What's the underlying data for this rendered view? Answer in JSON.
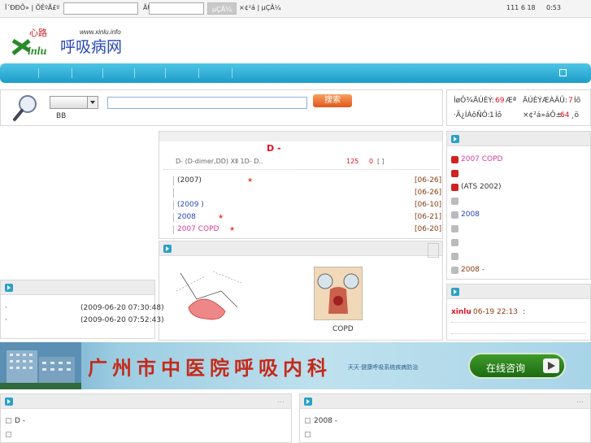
{
  "topbar": {
    "user_label": "Ï´ÐÐÕ» | ÕÊºÅ£º",
    "pass_label": "ÃÜÂë£º",
    "login_button": "µÇÂ¼",
    "register_links": "×¢²á | µÇÂ¼",
    "date": "111 6 18",
    "time": "0:53"
  },
  "logo": {
    "mark": "Xinlu",
    "url": "www.xinlu.info",
    "title": "呼吸病网",
    "top_glyph": "心路"
  },
  "search": {
    "select_value": "",
    "below_label": "BB",
    "button_label": "搜索"
  },
  "stats": {
    "line1_a": "ÍøÕ¾ÄÚÈÝ:",
    "line1_a_val": "69",
    "line1_a_unit": "Æª",
    "line1_b": "ÄÚÈÝÆÀÂÛ:",
    "line1_b_val": "7",
    "line1_b_unit": "Ìõ",
    "line2_a": "·Ã¿ÍÁôÑÔ:",
    "line2_a_val": "1",
    "line2_a_unit": "Ìõ",
    "line2_b": "×¢²á»áÔ±:",
    "line2_b_val": "64",
    "line2_b_unit": "¸ö"
  },
  "headline": {
    "title": "D -",
    "subtitle": "D-   (D-dimer,DD)       XⅡ                     1D-      D..",
    "hits": "125",
    "comments": "0",
    "more": "[ ]"
  },
  "news_list": [
    {
      "text": "(2007)",
      "date": "[06-26]",
      "star": true,
      "color": "dark"
    },
    {
      "text": "",
      "date": "[06-26]",
      "star": false,
      "color": "dark"
    },
    {
      "text": "(2009 )",
      "date": "[06-10]",
      "star": false,
      "color": "blue"
    },
    {
      "text": "2008",
      "date": "[06-21]",
      "star": true,
      "color": "blue"
    },
    {
      "text": "2007   COPD",
      "date": "[06-20]",
      "star": true,
      "color": "pink"
    }
  ],
  "image_panel": {
    "caption_right": "COPD"
  },
  "right_list": [
    {
      "num": "1",
      "text": "2007   COPD",
      "color": "pink"
    },
    {
      "num": "2",
      "text": "",
      "color": "dark"
    },
    {
      "num": "3",
      "text": "          (ATS 2002)",
      "color": "dark"
    },
    {
      "num": "4",
      "text": "",
      "color": "dark"
    },
    {
      "num": "5",
      "text": "2008",
      "color": "blue"
    },
    {
      "num": "6",
      "text": "",
      "color": "dark"
    },
    {
      "num": "7",
      "text": "",
      "color": "dark"
    },
    {
      "num": "8",
      "text": "",
      "color": "dark"
    },
    {
      "num": "9",
      "text": "2008        -",
      "color": "brown"
    }
  ],
  "comments_panel": {
    "user": "xinlu",
    "time": "06-19 22:13",
    "sep": ":"
  },
  "left_panel": {
    "rows": [
      {
        "text": "·",
        "date": "(2009-06-20 07:30:48)"
      },
      {
        "text": "·",
        "date": "(2009-06-20 07:52:43)"
      }
    ]
  },
  "banner": {
    "title": "广州市中医院呼吸内科",
    "slogan": "天天·健康呼吸系统疾病防治",
    "button": "在线咨询"
  },
  "bottom_left": {
    "more": "...",
    "items": [
      "D -",
      ""
    ]
  },
  "bottom_right": {
    "more": "...",
    "items": [
      "2008       -",
      ""
    ]
  },
  "colors": {
    "nav_top": "#4fc5e6",
    "nav_bottom": "#1b9dc8",
    "accent_red": "#d12222",
    "search_button": "#ef6a1a",
    "banner_bg": "#7ec0dc"
  }
}
